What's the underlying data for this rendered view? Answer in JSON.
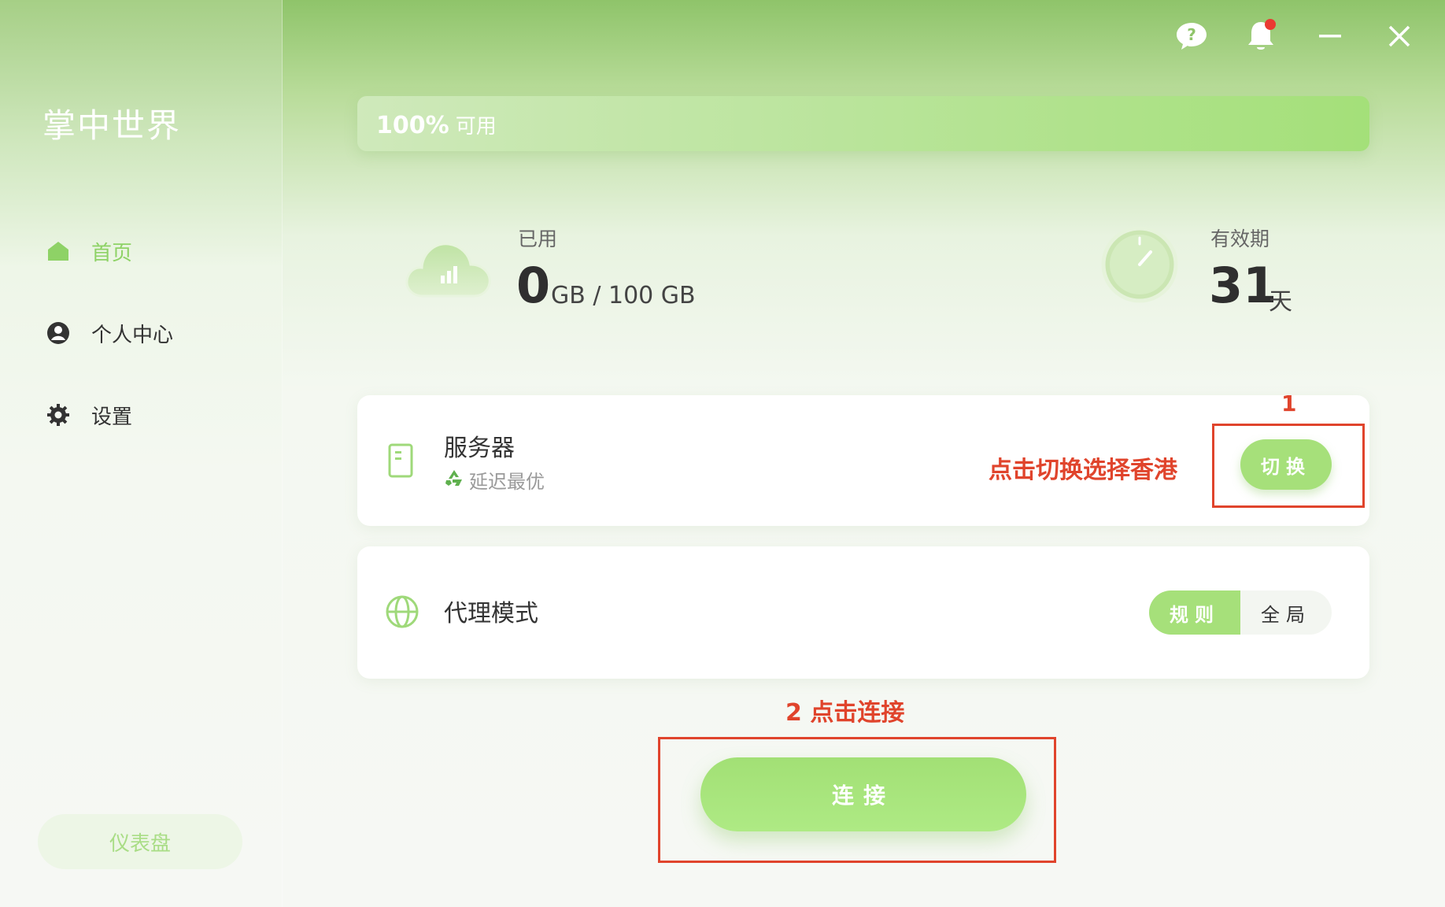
{
  "app": {
    "brand": "掌中世界"
  },
  "nav": {
    "items": [
      {
        "label": "首页",
        "icon": "home-icon",
        "active": true
      },
      {
        "label": "个人中心",
        "icon": "user-icon",
        "active": false
      },
      {
        "label": "设置",
        "icon": "gear-icon",
        "active": false
      }
    ],
    "dashboard_label": "仪表盘"
  },
  "window_controls": [
    "help-icon",
    "bell-icon",
    "minimize-icon",
    "close-icon"
  ],
  "quota": {
    "percent_text": "100%",
    "label": "可用",
    "available_fraction": 1.0
  },
  "usage": {
    "label": "已用",
    "used": "0",
    "total_text": "GB / 100 GB"
  },
  "validity": {
    "label": "有效期",
    "days": "31",
    "unit": "天"
  },
  "server": {
    "title": "服务器",
    "subtitle": "延迟最优",
    "switch_label": "切换"
  },
  "proxy": {
    "title": "代理模式",
    "options": [
      "规则",
      "全局"
    ],
    "selected": "规则"
  },
  "annotations": {
    "step1_number": "1",
    "step1_text": "点击切换选择香港",
    "step2_text": "2 点击连接"
  },
  "connect": {
    "label": "连接"
  },
  "colors": {
    "accent": "#a6e07a",
    "annotation": "#e0442c",
    "active_nav": "#8ed266"
  }
}
